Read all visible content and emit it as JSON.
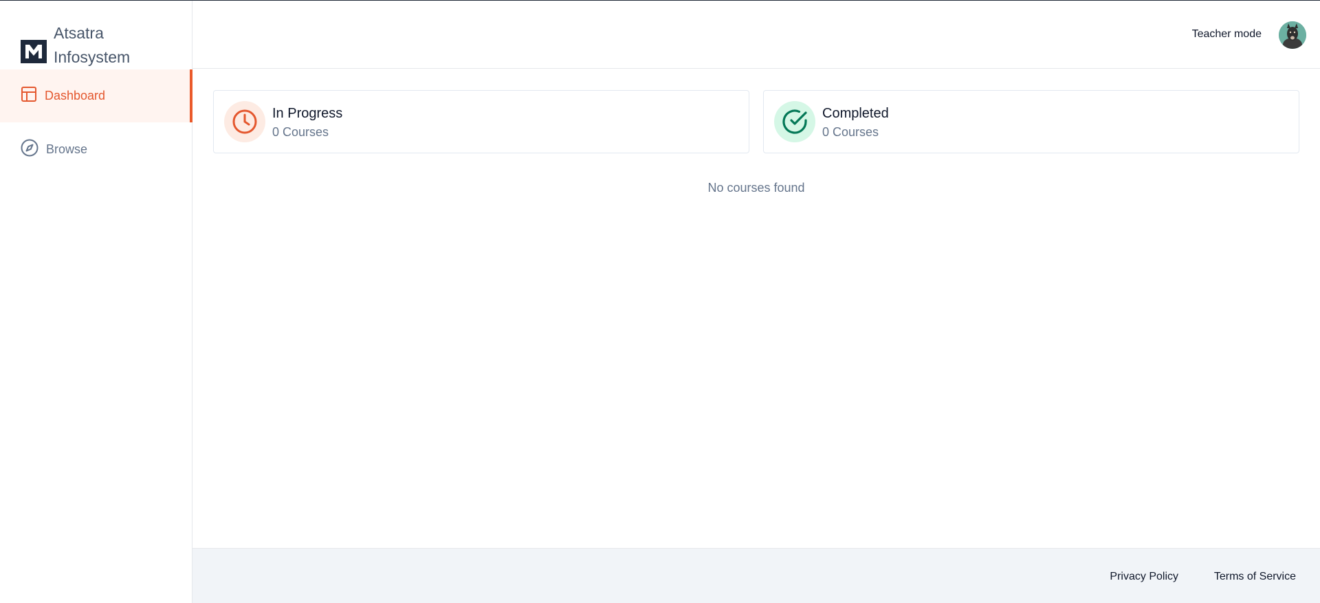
{
  "brand": {
    "name": "Atsatra Infosystem",
    "logo_icon": "brand-logo-icon"
  },
  "sidebar": {
    "items": [
      {
        "label": "Dashboard",
        "icon": "layout-icon",
        "active": true
      },
      {
        "label": "Browse",
        "icon": "compass-icon",
        "active": false
      }
    ]
  },
  "header": {
    "teacher_mode_label": "Teacher mode",
    "avatar_icon": "user-avatar"
  },
  "cards": [
    {
      "title": "In Progress",
      "subtitle": "0 Courses",
      "icon": "clock-icon",
      "color": "#e4572e"
    },
    {
      "title": "Completed",
      "subtitle": "0 Courses",
      "icon": "check-circle-icon",
      "color": "#047857"
    }
  ],
  "main": {
    "empty_message": "No courses found"
  },
  "footer": {
    "privacy_label": "Privacy Policy",
    "terms_label": "Terms of Service"
  },
  "colors": {
    "accent": "#ea5a2b",
    "success": "#047857",
    "footer_bg": "#f1f4f8"
  }
}
